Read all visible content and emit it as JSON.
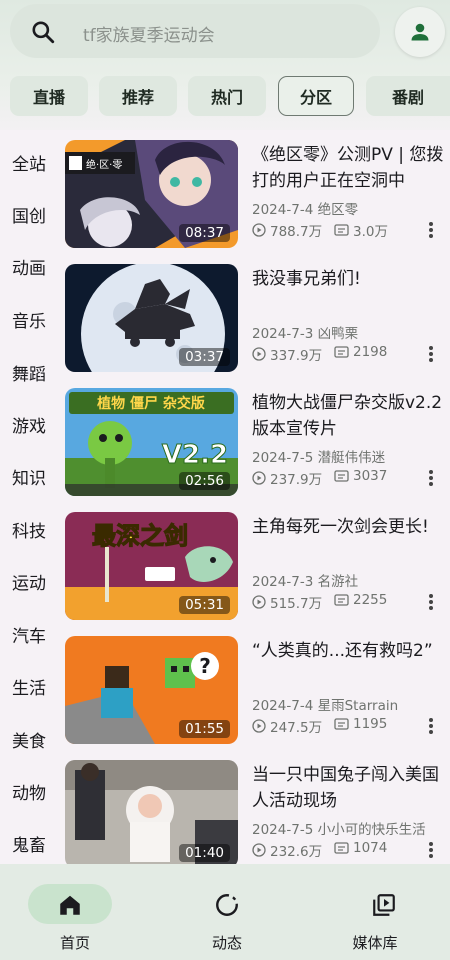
{
  "search": {
    "placeholder": "tf家族夏季运动会"
  },
  "tabs": [
    {
      "label": "直播"
    },
    {
      "label": "推荐"
    },
    {
      "label": "热门"
    },
    {
      "label": "分区",
      "active": true
    },
    {
      "label": "番剧"
    }
  ],
  "categories": [
    "全站",
    "国创",
    "动画",
    "音乐",
    "舞蹈",
    "游戏",
    "知识",
    "科技",
    "运动",
    "汽车",
    "生活",
    "美食",
    "动物",
    "鬼畜"
  ],
  "videos": [
    {
      "title": "《绝区零》公测PV | 您拨打的用户正在空洞中",
      "date": "2024-7-4",
      "author": "绝区零",
      "views": "788.7万",
      "danmaku": "3.0万",
      "duration": "08:37"
    },
    {
      "title": "我没事兄弟们!",
      "date": "2024-7-3",
      "author": "凶鸭栗",
      "views": "337.9万",
      "danmaku": "2198",
      "duration": "03:37"
    },
    {
      "title": "植物大战僵尸杂交版v2.2版本宣传片",
      "date": "2024-7-5",
      "author": "潜艇伟伟迷",
      "views": "237.9万",
      "danmaku": "3037",
      "duration": "02:56"
    },
    {
      "title": "主角每死一次剑会更长!",
      "date": "2024-7-3",
      "author": "名游社",
      "views": "515.7万",
      "danmaku": "2255",
      "duration": "05:31"
    },
    {
      "title": "“人类真的...还有救吗2”",
      "date": "2024-7-4",
      "author": "星雨Starrain",
      "views": "247.5万",
      "danmaku": "1195",
      "duration": "01:55"
    },
    {
      "title": "当一只中国兔子闯入美国人活动现场",
      "date": "2024-7-5",
      "author": "小小可的快乐生活",
      "views": "232.6万",
      "danmaku": "1074",
      "duration": "01:40"
    }
  ],
  "thumb_text": {
    "v0_logo": "绝·区·零",
    "v2_title": "植物 僵尸 杂交版",
    "v2_version": "V2.2",
    "v3_title": "最深之剑",
    "v4_mark": "?"
  },
  "nav": [
    {
      "label": "首页",
      "icon": "home-icon",
      "active": true
    },
    {
      "label": "动态",
      "icon": "dynamic-icon"
    },
    {
      "label": "媒体库",
      "icon": "media-library-icon"
    }
  ],
  "colors": {
    "accent": "#1f6f3a",
    "nav_active": "#c9e3cd",
    "tab_bg": "#dfe8e0"
  }
}
